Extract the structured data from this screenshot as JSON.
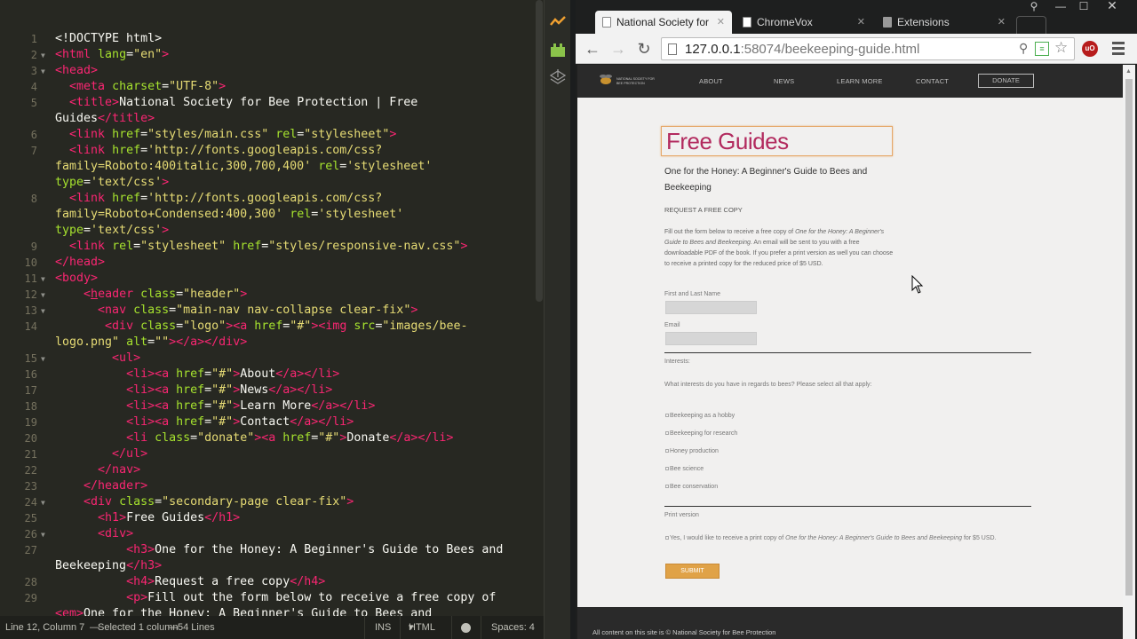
{
  "editor": {
    "lines": [
      {
        "n": "1",
        "fold": "",
        "html": "<span class='p'>&lt;!DOCTYPE html&gt;</span>"
      },
      {
        "n": "2",
        "fold": "▼",
        "html": "<span class='t'>&lt;html</span> <span class='a'>lang</span><span class='p'>=</span><span class='s'>\"en\"</span><span class='t'>&gt;</span>"
      },
      {
        "n": "3",
        "fold": "▼",
        "html": "<span class='t'>&lt;head&gt;</span>"
      },
      {
        "n": "4",
        "fold": "",
        "html": "  <span class='t'>&lt;meta</span> <span class='a'>charset</span><span class='p'>=</span><span class='s'>\"UTF-8\"</span><span class='t'>&gt;</span>"
      },
      {
        "n": "5",
        "fold": "",
        "html": "  <span class='t'>&lt;title&gt;</span><span class='p'>National Society for Bee Protection | Free</span>"
      },
      {
        "n": "",
        "fold": "",
        "html": "<span class='p'>Guides</span><span class='t'>&lt;/title&gt;</span>"
      },
      {
        "n": "6",
        "fold": "",
        "html": "  <span class='t'>&lt;link</span> <span class='a'>href</span><span class='p'>=</span><span class='s'>\"styles/main.css\"</span> <span class='a'>rel</span><span class='p'>=</span><span class='s'>\"stylesheet\"</span><span class='t'>&gt;</span>"
      },
      {
        "n": "7",
        "fold": "",
        "html": "  <span class='t'>&lt;link</span> <span class='a'>href</span><span class='p'>=</span><span class='s'>'http://fonts.googleapis.com/css?</span>"
      },
      {
        "n": "",
        "fold": "",
        "html": "<span class='s'>family=Roboto:400italic,300,700,400'</span> <span class='a'>rel</span><span class='p'>=</span><span class='s'>'stylesheet'</span>"
      },
      {
        "n": "",
        "fold": "",
        "html": "<span class='a'>type</span><span class='p'>=</span><span class='s'>'text/css'</span><span class='t'>&gt;</span>"
      },
      {
        "n": "8",
        "fold": "",
        "html": "  <span class='t'>&lt;link</span> <span class='a'>href</span><span class='p'>=</span><span class='s'>'http://fonts.googleapis.com/css?</span>"
      },
      {
        "n": "",
        "fold": "",
        "html": "<span class='s'>family=Roboto+Condensed:400,300'</span> <span class='a'>rel</span><span class='p'>=</span><span class='s'>'stylesheet'</span>"
      },
      {
        "n": "",
        "fold": "",
        "html": "<span class='a'>type</span><span class='p'>=</span><span class='s'>'text/css'</span><span class='t'>&gt;</span>"
      },
      {
        "n": "9",
        "fold": "",
        "html": "  <span class='t'>&lt;link</span> <span class='a'>rel</span><span class='p'>=</span><span class='s'>\"stylesheet\"</span> <span class='a'>href</span><span class='p'>=</span><span class='s'>\"styles/responsive-nav.css\"</span><span class='t'>&gt;</span>"
      },
      {
        "n": "10",
        "fold": "",
        "html": "<span class='t'>&lt;/head&gt;</span>"
      },
      {
        "n": "11",
        "fold": "▼",
        "html": "<span class='t'>&lt;body&gt;</span>"
      },
      {
        "n": "12",
        "fold": "▼",
        "html": "    <span class='t'>&lt;</span><span class='t' style='text-decoration:underline'>h</span><span class='t'>eader</span> <span class='a'>class</span><span class='p'>=</span><span class='s'>\"header\"</span><span class='t'>&gt;</span>"
      },
      {
        "n": "13",
        "fold": "▼",
        "html": "      <span class='t'>&lt;nav</span> <span class='a'>class</span><span class='p'>=</span><span class='s'>\"main-nav nav-collapse clear-fix\"</span><span class='t'>&gt;</span>"
      },
      {
        "n": "14",
        "fold": "",
        "html": "       <span class='t'>&lt;div</span> <span class='a'>class</span><span class='p'>=</span><span class='s'>\"logo\"</span><span class='t'>&gt;&lt;a</span> <span class='a'>href</span><span class='p'>=</span><span class='s'>\"#\"</span><span class='t'>&gt;&lt;img</span> <span class='a'>src</span><span class='p'>=</span><span class='s'>\"images/bee-</span>"
      },
      {
        "n": "",
        "fold": "",
        "html": "<span class='s'>logo.png\"</span> <span class='a'>alt</span><span class='p'>=</span><span class='s'>\"\"</span><span class='t'>&gt;&lt;/a&gt;&lt;/div&gt;</span>"
      },
      {
        "n": "15",
        "fold": "▼",
        "html": "        <span class='t'>&lt;ul&gt;</span>"
      },
      {
        "n": "16",
        "fold": "",
        "html": "          <span class='t'>&lt;li&gt;&lt;a</span> <span class='a'>href</span><span class='p'>=</span><span class='s'>\"#\"</span><span class='t'>&gt;</span><span class='p'>About</span><span class='t'>&lt;/a&gt;&lt;/li&gt;</span>"
      },
      {
        "n": "17",
        "fold": "",
        "html": "          <span class='t'>&lt;li&gt;&lt;a</span> <span class='a'>href</span><span class='p'>=</span><span class='s'>\"#\"</span><span class='t'>&gt;</span><span class='p'>News</span><span class='t'>&lt;/a&gt;&lt;/li&gt;</span>"
      },
      {
        "n": "18",
        "fold": "",
        "html": "          <span class='t'>&lt;li&gt;&lt;a</span> <span class='a'>href</span><span class='p'>=</span><span class='s'>\"#\"</span><span class='t'>&gt;</span><span class='p'>Learn More</span><span class='t'>&lt;/a&gt;&lt;/li&gt;</span>"
      },
      {
        "n": "19",
        "fold": "",
        "html": "          <span class='t'>&lt;li&gt;&lt;a</span> <span class='a'>href</span><span class='p'>=</span><span class='s'>\"#\"</span><span class='t'>&gt;</span><span class='p'>Contact</span><span class='t'>&lt;/a&gt;&lt;/li&gt;</span>"
      },
      {
        "n": "20",
        "fold": "",
        "html": "          <span class='t'>&lt;li</span> <span class='a'>class</span><span class='p'>=</span><span class='s'>\"donate\"</span><span class='t'>&gt;&lt;a</span> <span class='a'>href</span><span class='p'>=</span><span class='s'>\"#\"</span><span class='t'>&gt;</span><span class='p'>Donate</span><span class='t'>&lt;/a&gt;&lt;/li&gt;</span>"
      },
      {
        "n": "21",
        "fold": "",
        "html": "        <span class='t'>&lt;/ul&gt;</span>"
      },
      {
        "n": "22",
        "fold": "",
        "html": "      <span class='t'>&lt;/nav&gt;</span>"
      },
      {
        "n": "23",
        "fold": "",
        "html": "    <span class='t'>&lt;/header&gt;</span>"
      },
      {
        "n": "24",
        "fold": "▼",
        "html": "    <span class='t'>&lt;div</span> <span class='a'>class</span><span class='p'>=</span><span class='s'>\"secondary-page clear-fix\"</span><span class='t'>&gt;</span>"
      },
      {
        "n": "25",
        "fold": "",
        "html": "      <span class='t'>&lt;h1&gt;</span><span class='p'>Free Guides</span><span class='t'>&lt;/h1&gt;</span>"
      },
      {
        "n": "26",
        "fold": "▼",
        "html": "      <span class='t'>&lt;div&gt;</span>"
      },
      {
        "n": "27",
        "fold": "",
        "html": "          <span class='t'>&lt;h3&gt;</span><span class='p'>One for the Honey: A Beginner's Guide to Bees and</span>"
      },
      {
        "n": "",
        "fold": "",
        "html": "<span class='p'>Beekeeping</span><span class='t'>&lt;/h3&gt;</span>"
      },
      {
        "n": "28",
        "fold": "",
        "html": "          <span class='t'>&lt;h4&gt;</span><span class='p'>Request a free copy</span><span class='t'>&lt;/h4&gt;</span>"
      },
      {
        "n": "29",
        "fold": "",
        "html": "          <span class='t'>&lt;p&gt;</span><span class='p'>Fill out the form below to receive a free copy of</span>"
      },
      {
        "n": "",
        "fold": "",
        "html": "<span class='t'>&lt;em&gt;</span><span class='p'>One for the Honey: A Beginner's Guide to Bees and</span>"
      }
    ],
    "status": {
      "position": "Line 12, Column 7",
      "selection": "Selected 1 column",
      "lines": "54 Lines",
      "mode": "INS",
      "syntax": "HTML",
      "spaces": "Spaces: 4"
    }
  },
  "browser": {
    "tabs": [
      {
        "label": "National Society for Be",
        "active": true
      },
      {
        "label": "ChromeVox",
        "active": false
      },
      {
        "label": "Extensions",
        "active": false
      }
    ],
    "url_host": "127.0.0.1",
    "url_rest": ":58074/beekeeping-guide.html"
  },
  "page": {
    "logo_text_1": "NATIONAL SOCIETY FOR",
    "logo_text_2": "BEE PROTECTION",
    "nav": [
      "ABOUT",
      "NEWS",
      "LEARN MORE",
      "CONTACT"
    ],
    "donate": "DONATE",
    "h1": "Free Guides",
    "h3": "One for the Honey: A Beginner's Guide to Bees and Beekeeping",
    "h4": "REQUEST A FREE COPY",
    "para_1": "Fill out the form below to receive a free copy of ",
    "para_em": "One for the Honey: A Beginner's Guide to Bees and Beekeeping",
    "para_2": ". An email will be sent to you with a free downloadable PDF of the book. If you prefer a print version as well you can choose to receive a printed copy for the reduced price of $5 USD.",
    "name_label": "First and Last Name",
    "email_label": "Email",
    "interests_label": "Interests:",
    "interests_q": "What interests do you have in regards to bees? Please select all that apply:",
    "interests": [
      "Beekeeping as a hobby",
      "Beekeeping for research",
      "Honey production",
      "Bee science",
      "Bee conservation"
    ],
    "print_label": "Print version",
    "print_1": "Yes, I would like to receive a print copy of ",
    "print_em": "One for the Honey: A Beginner's Guide to Bees and Beekeeping",
    "print_2": " for $5 USD.",
    "submit": "SUBMIT",
    "footer": "All content on this site is © National Society for Bee Protection"
  },
  "colors": {
    "editor_bg": "#272822",
    "tag": "#f92672",
    "attr": "#a6e22e",
    "string": "#e6db74",
    "heading": "#b22a5e",
    "accent": "#e0a247"
  }
}
